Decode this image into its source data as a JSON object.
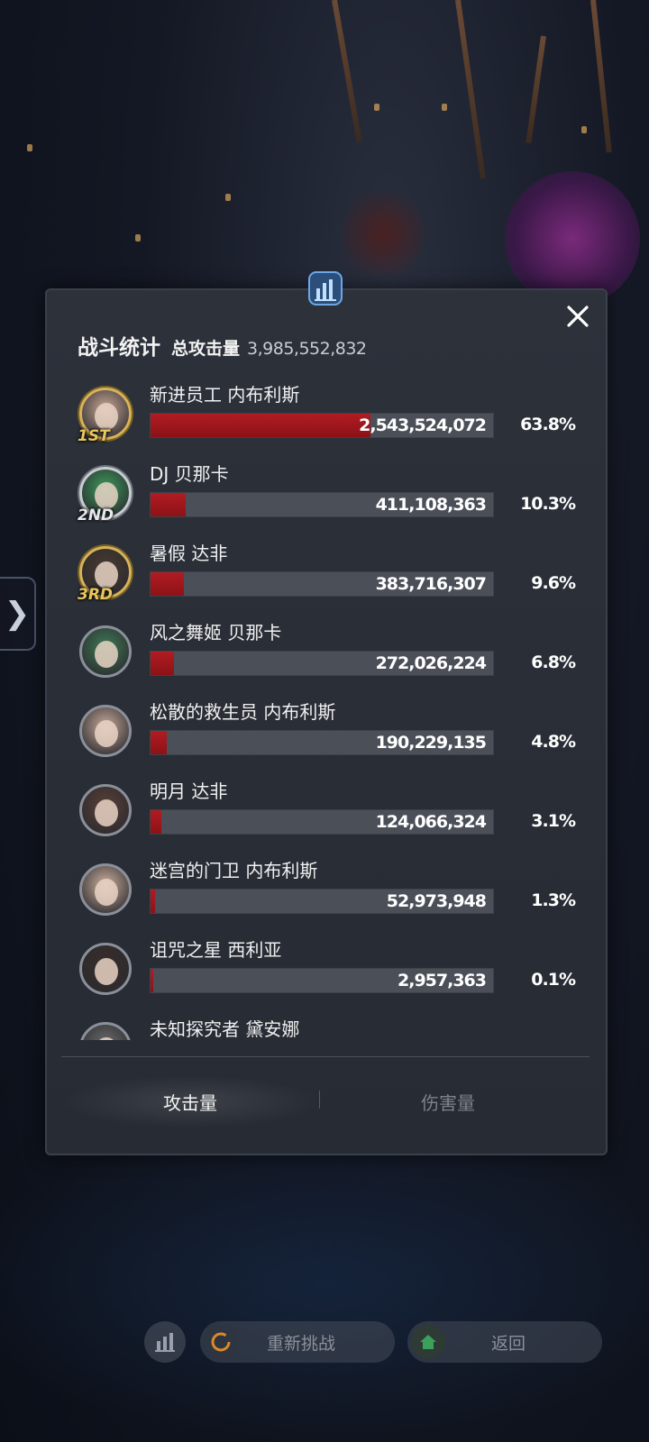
{
  "panel": {
    "title": "战斗统计",
    "total_label": "总攻击量",
    "total_value": "3,985,552,832",
    "close_icon": "close-icon",
    "emblem_icon": "bar-chart-icon"
  },
  "rows": [
    {
      "name": "新进员工 内布利斯",
      "value": "2,543,524,072",
      "percent": "63.8%",
      "fill": 0.638,
      "rank": "1ST",
      "rank_tier": "gold",
      "avatar_color": "#c9a894"
    },
    {
      "name": "DJ 贝那卡",
      "value": "411,108,363",
      "percent": "10.3%",
      "fill": 0.103,
      "rank": "2ND",
      "rank_tier": "silver",
      "avatar_color": "#3d9a5c"
    },
    {
      "name": "暑假 达非",
      "value": "383,716,307",
      "percent": "9.6%",
      "fill": 0.096,
      "rank": "3RD",
      "rank_tier": "gold",
      "avatar_color": "#4a3a30"
    },
    {
      "name": "风之舞姬 贝那卡",
      "value": "272,026,224",
      "percent": "6.8%",
      "fill": 0.068,
      "rank": "",
      "rank_tier": "none",
      "avatar_color": "#3f7a55"
    },
    {
      "name": "松散的救生员 内布利斯",
      "value": "190,229,135",
      "percent": "4.8%",
      "fill": 0.048,
      "rank": "",
      "rank_tier": "none",
      "avatar_color": "#c7a99a"
    },
    {
      "name": "明月 达非",
      "value": "124,066,324",
      "percent": "3.1%",
      "fill": 0.031,
      "rank": "",
      "rank_tier": "none",
      "avatar_color": "#5a4038"
    },
    {
      "name": "迷宫的门卫 内布利斯",
      "value": "52,973,948",
      "percent": "1.3%",
      "fill": 0.013,
      "rank": "",
      "rank_tier": "none",
      "avatar_color": "#cdb09e"
    },
    {
      "name": "诅咒之星 西利亚",
      "value": "2,957,363",
      "percent": "0.1%",
      "fill": 0.001,
      "rank": "",
      "rank_tier": "none",
      "avatar_color": "#3a2e2a"
    },
    {
      "name": "未知探究者 黛安娜",
      "value": "",
      "percent": "",
      "fill": 0,
      "rank": "",
      "rank_tier": "none",
      "avatar_color": "#6a6a6a"
    }
  ],
  "tabs": {
    "attack": "攻击量",
    "damage": "伤害量"
  },
  "bottom_bar": {
    "stats_icon": "bar-chart-icon",
    "retry_icon": "refresh-icon",
    "retry_label": "重新挑战",
    "back_icon": "home-icon",
    "back_label": "返回"
  },
  "side_tab_icon": "chevron-right-icon",
  "colors": {
    "bar_fill": "#b11c22",
    "bar_track": "#4a4f58",
    "gold": "#d7b25a",
    "silver": "#c8ccd2"
  }
}
